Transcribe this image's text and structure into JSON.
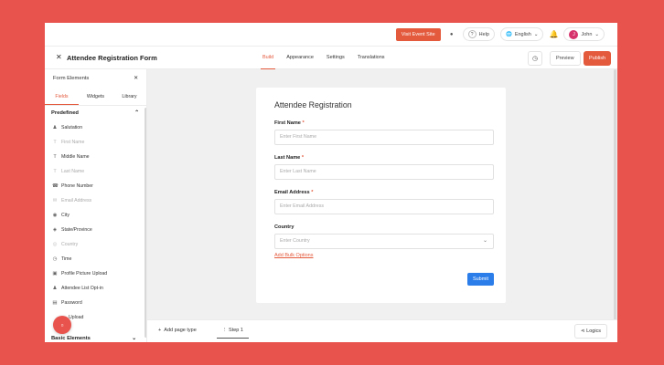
{
  "topbar": {
    "visit_label": "Visit Event Site",
    "help_label": "Help",
    "language_label": "English",
    "user_name": "John",
    "user_initial": "J"
  },
  "editor": {
    "form_title": "Attendee Registration Form",
    "tabs": [
      {
        "label": "Build",
        "active": true
      },
      {
        "label": "Appearance",
        "active": false
      },
      {
        "label": "Settings",
        "active": false
      },
      {
        "label": "Translations",
        "active": false
      }
    ],
    "preview_label": "Preview",
    "publish_label": "Publish"
  },
  "sidebar": {
    "title": "Form Elements",
    "tabs": [
      {
        "label": "Fields",
        "active": true
      },
      {
        "label": "Widgets",
        "active": false
      },
      {
        "label": "Library",
        "active": false
      }
    ],
    "section_predefined": "Predefined",
    "fields": [
      {
        "label": "Salutation",
        "icon": "people-icon",
        "muted": false
      },
      {
        "label": "First Name",
        "icon": "text-icon",
        "muted": true
      },
      {
        "label": "Middle Name",
        "icon": "text-icon",
        "muted": false
      },
      {
        "label": "Last Name",
        "icon": "text-icon",
        "muted": true
      },
      {
        "label": "Phone Number",
        "icon": "phone-icon",
        "muted": false
      },
      {
        "label": "Email Address",
        "icon": "mail-icon",
        "muted": true
      },
      {
        "label": "City",
        "icon": "location-icon",
        "muted": false
      },
      {
        "label": "State/Province",
        "icon": "map-icon",
        "muted": false
      },
      {
        "label": "Country",
        "icon": "globe-icon",
        "muted": true
      },
      {
        "label": "Time",
        "icon": "clock-icon",
        "muted": false
      },
      {
        "label": "Profile Picture Upload",
        "icon": "image-icon",
        "muted": false
      },
      {
        "label": "Attendee List Opt-in",
        "icon": "people-icon",
        "muted": false
      },
      {
        "label": "Password",
        "icon": "lock-icon",
        "muted": false
      },
      {
        "label": "Upload",
        "icon": "upload-icon",
        "muted": false
      }
    ],
    "section_basic": "Basic Elements"
  },
  "form": {
    "title": "Attendee Registration",
    "fields": [
      {
        "label": "First Name",
        "required": "*",
        "placeholder": "Enter First Name"
      },
      {
        "label": "Last Name",
        "required": "*",
        "placeholder": "Enter Last Name"
      },
      {
        "label": "Email Address",
        "required": "*",
        "placeholder": "Enter Email Address"
      },
      {
        "label": "Country",
        "required": "",
        "placeholder": "Enter Country"
      }
    ],
    "bulk_label": "Add Bulk Options",
    "submit_label": "Submit"
  },
  "bottombar": {
    "add_page_label": "Add page type",
    "step_label": "Step 1",
    "logics_label": "Logics"
  },
  "colors": {
    "background": "#e8544d",
    "accent": "#e35a3d",
    "submit": "#2b7de9"
  }
}
